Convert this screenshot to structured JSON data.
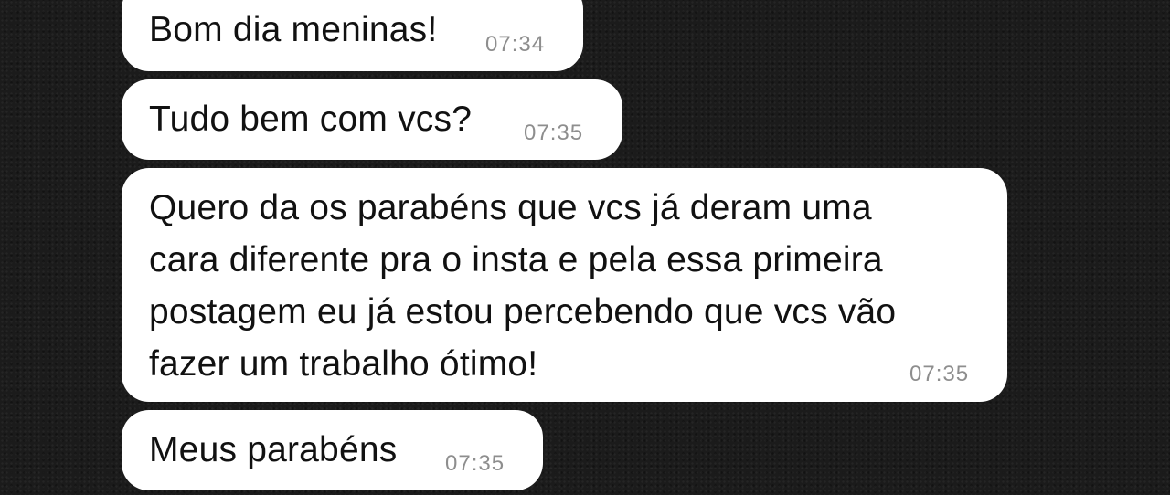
{
  "messages": [
    {
      "text": "Bom dia meninas!",
      "time": "07:34"
    },
    {
      "text": "Tudo bem com vcs?",
      "time": "07:35"
    },
    {
      "lines": [
        "Quero da os parabéns que vcs já deram uma",
        "cara diferente pra o insta e pela essa primeira",
        "postagem eu já estou percebendo que vcs vão",
        "fazer um trabalho ótimo!"
      ],
      "time": "07:35"
    },
    {
      "text": "Meus parabéns",
      "time": "07:35"
    }
  ]
}
